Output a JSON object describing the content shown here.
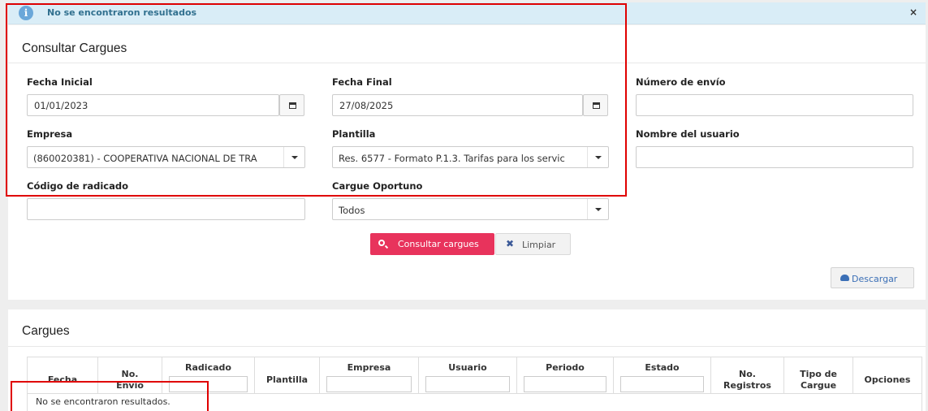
{
  "alert": {
    "message": "No se encontraron resultados",
    "close": "×"
  },
  "consult_panel": {
    "title": "Consultar Cargues",
    "fecha_inicial": {
      "label": "Fecha Inicial",
      "value": "01/01/2023"
    },
    "fecha_final": {
      "label": "Fecha Final",
      "value": "27/08/2025"
    },
    "numero_envio": {
      "label": "Número de envío",
      "value": ""
    },
    "empresa": {
      "label": "Empresa",
      "value": "(860020381) - COOPERATIVA NACIONAL DE TRA"
    },
    "plantilla": {
      "label": "Plantilla",
      "value": "Res. 6577 - Formato P.1.3. Tarifas para los servic"
    },
    "nombre_usuario": {
      "label": "Nombre del usuario",
      "value": ""
    },
    "codigo_radicado": {
      "label": "Código de radicado",
      "value": ""
    },
    "cargue_oportuno": {
      "label": "Cargue Oportuno",
      "value": "Todos"
    },
    "buttons": {
      "consultar": "Consultar cargues",
      "limpiar": "Limpiar",
      "descargar": "Descargar"
    }
  },
  "results_panel": {
    "title": "Cargues",
    "columns": [
      "Fecha",
      "No.\nEnvío",
      "Radicado",
      "Plantilla",
      "Empresa",
      "Usuario",
      "Periodo",
      "Estado",
      "No.\nRegistros",
      "Tipo de\nCargue",
      "Opciones"
    ],
    "empty_message": "No se encontraron resultados."
  },
  "colors": {
    "primary": "#e8335c",
    "alert_bg": "#d9edf7",
    "alert_text": "#31708f",
    "highlight": "#e00000"
  }
}
